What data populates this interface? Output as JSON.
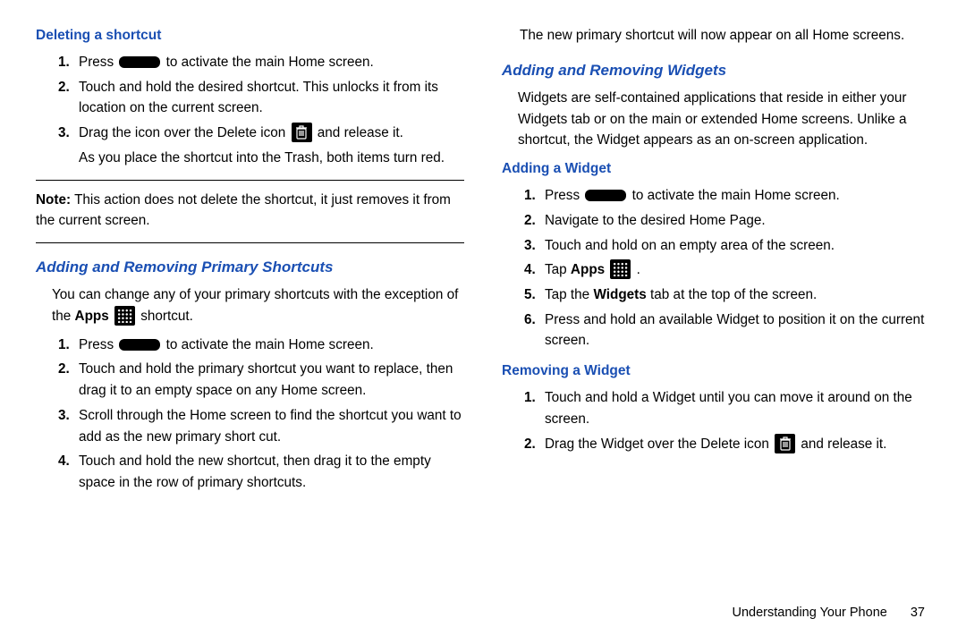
{
  "left": {
    "h_delete": "Deleting a shortcut",
    "del_steps": {
      "s1a": "Press ",
      "s1b": " to activate the main Home screen.",
      "s2": "Touch and hold the desired shortcut. This unlocks it from its location on the current screen.",
      "s3a": "Drag the icon over the Delete icon ",
      "s3b": " and release it.",
      "s3c": "As you place the shortcut into the Trash, both items turn red."
    },
    "note_label": "Note:",
    "note_text": " This action does not delete the shortcut, it just removes it from the current screen.",
    "h_primary": "Adding and Removing Primary Shortcuts",
    "primary_intro_a": "You can change any of your primary shortcuts with the exception of the ",
    "primary_intro_apps": "Apps",
    "primary_intro_b": " shortcut.",
    "prim_steps": {
      "s1a": "Press ",
      "s1b": " to activate the main Home screen.",
      "s2": "Touch and hold the primary shortcut you want to replace, then drag it to an empty space on any Home screen.",
      "s3": "Scroll through the Home screen to find the shortcut you want to add as the new primary short cut.",
      "s4": "Touch and hold the new shortcut, then drag it to the empty space in the row of primary shortcuts."
    }
  },
  "right": {
    "cont": "The new primary shortcut will now appear on all Home screens.",
    "h_widgets": "Adding and Removing Widgets",
    "widgets_intro": "Widgets are self-contained applications that reside in either your Widgets tab or on the main or extended Home screens. Unlike a shortcut, the Widget appears as an on-screen application.",
    "h_add_widget": "Adding a Widget",
    "add_steps": {
      "s1a": "Press ",
      "s1b": " to activate the main Home screen.",
      "s2": "Navigate to the desired Home Page.",
      "s3": "Touch and hold on an empty area of the screen.",
      "s4a": "Tap ",
      "s4apps": "Apps",
      "s4b": " .",
      "s5a": "Tap the ",
      "s5w": "Widgets",
      "s5b": " tab at the top of the screen.",
      "s6": "Press and hold an available Widget to position it on the current screen."
    },
    "h_remove_widget": "Removing a Widget",
    "rem_steps": {
      "s1": "Touch and hold a Widget until you can move it around on the screen.",
      "s2a": "Drag the Widget over the Delete icon ",
      "s2b": " and release it."
    }
  },
  "footer": {
    "section": "Understanding Your Phone",
    "page": "37"
  }
}
